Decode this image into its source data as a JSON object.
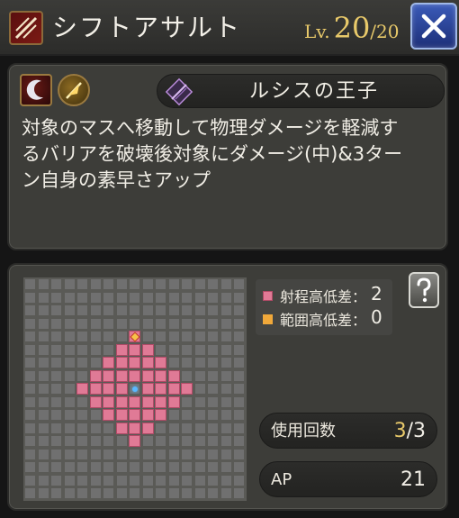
{
  "header": {
    "skill_name": "シフトアサルト",
    "level_label": "Lv.",
    "level_current": "20",
    "level_separator": "/",
    "level_max": "20",
    "skill_type_icon": "slash-attack-icon",
    "close_icon": "close-icon"
  },
  "description": {
    "tag_icons": [
      "crescent-blade-icon",
      "golden-feather-icon"
    ],
    "character_emblem": "noctis-emblem-icon",
    "character_name": "ルシスの王子",
    "text_lines": [
      "対象のマスへ移動して物理ダメージを軽減す",
      "るバリアを破壊後対象にダメージ(中)&3ター",
      "ン自身の素早さアップ"
    ]
  },
  "range": {
    "legend": [
      {
        "label": "射程高低差：",
        "value": "2",
        "color": "#e07a96"
      },
      {
        "label": "範囲高低差：",
        "value": "0",
        "color": "#f0a83a"
      }
    ],
    "grid_size": 17,
    "origin": [
      8,
      8
    ],
    "target_radius_min": 1,
    "target_radius_max": 4,
    "help_icon": "help-question-icon"
  },
  "stats": {
    "uses_label": "使用回数",
    "uses_current": "3",
    "uses_separator": "/",
    "uses_max": "3",
    "ap_label": "AP",
    "ap_value": "21"
  },
  "colors": {
    "accent_gold": "#e8c96a",
    "target_pink": "#e07a96",
    "close_blue": "#2a4aa8"
  }
}
